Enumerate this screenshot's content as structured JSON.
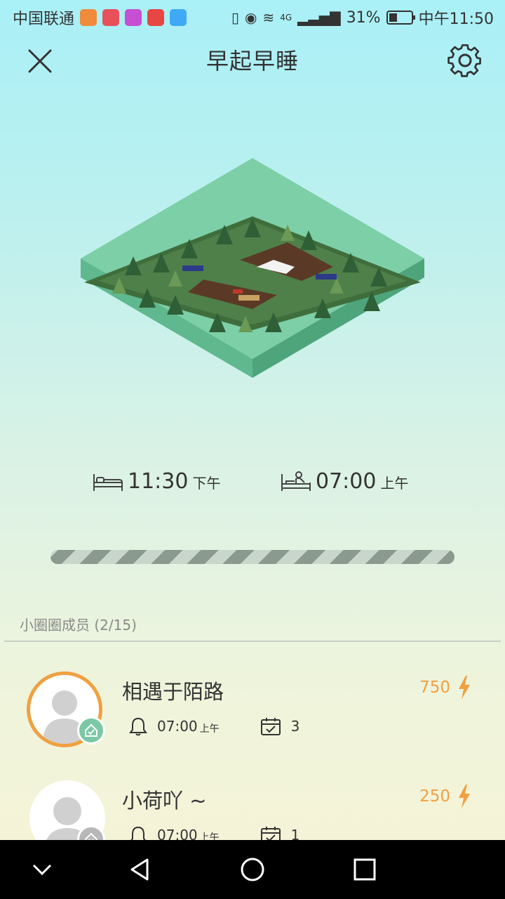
{
  "status_bar": {
    "carrier": "中国联通",
    "network": "4G",
    "battery": "31%",
    "time": "中午11:50",
    "app_icon_colors": [
      "#f08a3c",
      "#e8505b",
      "#c74fd4",
      "#e84545",
      "#3fa9f5"
    ]
  },
  "header": {
    "title": "早起早睡",
    "close_icon": "close-icon",
    "settings_icon": "gear-icon"
  },
  "schedule": {
    "sleep_time": "11:30",
    "sleep_ampm": "下午",
    "wake_time": "07:00",
    "wake_ampm": "上午"
  },
  "members": {
    "title": "小圈圈成员 (2/15)",
    "list": [
      {
        "name": "相遇于陌路",
        "score": "750",
        "alarm_time": "07:00",
        "alarm_ampm": "上午",
        "checkins": "3",
        "status": "checked-in"
      },
      {
        "name": "小荷吖 ~",
        "score": "250",
        "alarm_time": "07:00",
        "alarm_ampm": "上午",
        "checkins": "1",
        "status": "not-checked-in"
      }
    ]
  },
  "colors": {
    "accent_orange": "#f0a040",
    "badge_green": "#7bc8a4",
    "badge_grey": "#b8b8b8"
  }
}
